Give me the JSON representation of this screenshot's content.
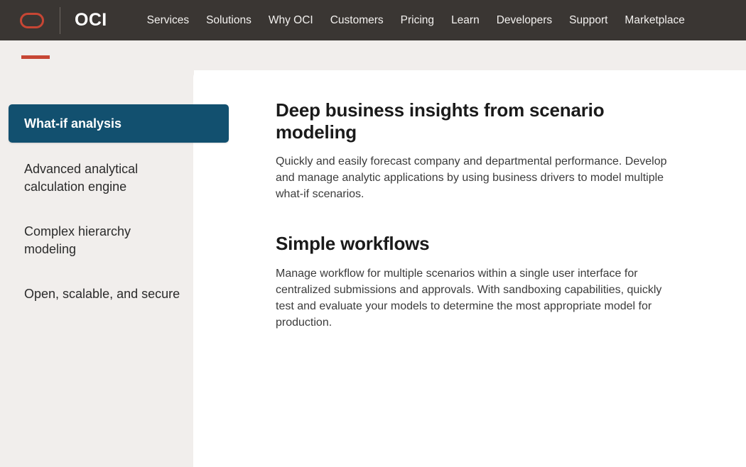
{
  "header": {
    "logo_icon": "oracle-logo-icon",
    "brand": "OCI",
    "nav": [
      {
        "label": "Services"
      },
      {
        "label": "Solutions"
      },
      {
        "label": "Why OCI"
      },
      {
        "label": "Customers"
      },
      {
        "label": "Pricing"
      },
      {
        "label": "Learn"
      },
      {
        "label": "Developers"
      },
      {
        "label": "Support"
      },
      {
        "label": "Marketplace"
      }
    ]
  },
  "colors": {
    "nav_background": "#3a3633",
    "band_background": "#f1eeec",
    "accent_red": "#c74634",
    "active_tab_blue": "#12506f",
    "panel_white": "#ffffff",
    "body_text": "#3b3b3b"
  },
  "sidebar": {
    "items": [
      {
        "label": "What-if analysis",
        "active": true
      },
      {
        "label": "Advanced analytical calculation engine",
        "active": false
      },
      {
        "label": "Complex hierarchy modeling",
        "active": false
      },
      {
        "label": "Open, scalable, and secure",
        "active": false
      }
    ]
  },
  "main": {
    "sections": [
      {
        "heading": "Deep business insights from scenario modeling",
        "body": "Quickly and easily forecast company and departmental performance. Develop and manage analytic applications by using business drivers to model multiple what-if scenarios."
      },
      {
        "heading": "Simple workflows",
        "body": "Manage workflow for multiple scenarios within a single user interface for centralized submissions and approvals. With sandboxing capabilities, quickly test and evaluate your models to determine the most appropriate model for production."
      }
    ]
  }
}
